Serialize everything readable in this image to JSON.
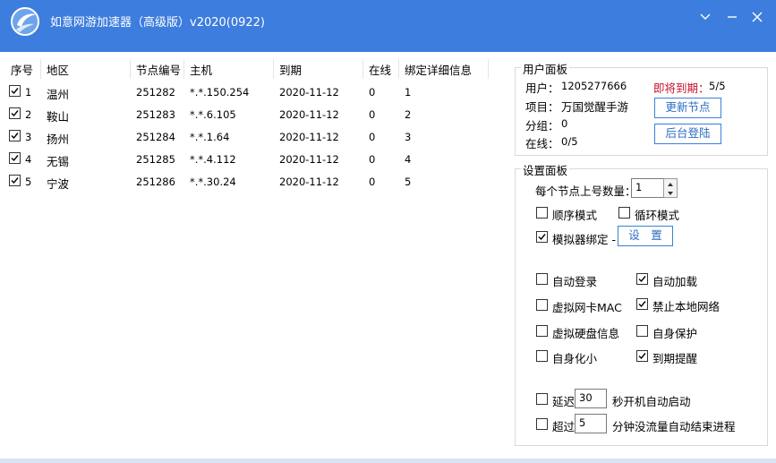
{
  "window": {
    "title": "如意网游加速器（高级版）v2020(0922)",
    "accent": "#3d7dde"
  },
  "table": {
    "headers": [
      "序号",
      "地区",
      "节点编号",
      "主机",
      "到期",
      "在线",
      "绑定详细信息"
    ],
    "rows": [
      {
        "checked": true,
        "index": "1",
        "region": "温州",
        "node": "251282",
        "host": "*.*.150.254",
        "expire": "2020-11-12",
        "online": "0",
        "bind": "1"
      },
      {
        "checked": true,
        "index": "2",
        "region": "鞍山",
        "node": "251283",
        "host": "*.*.6.105",
        "expire": "2020-11-12",
        "online": "0",
        "bind": "2"
      },
      {
        "checked": true,
        "index": "3",
        "region": "扬州",
        "node": "251284",
        "host": "*.*.1.64",
        "expire": "2020-11-12",
        "online": "0",
        "bind": "3"
      },
      {
        "checked": true,
        "index": "4",
        "region": "无锡",
        "node": "251285",
        "host": "*.*.4.112",
        "expire": "2020-11-12",
        "online": "0",
        "bind": "4"
      },
      {
        "checked": true,
        "index": "5",
        "region": "宁波",
        "node": "251286",
        "host": "*.*.30.24",
        "expire": "2020-11-12",
        "online": "0",
        "bind": "5"
      }
    ]
  },
  "user_panel": {
    "title": "用户面板",
    "user_label": "用户：",
    "user_value": "1205277666",
    "expiring_label": "即将到期：",
    "expiring_value": "5/5",
    "expiring_color": "#c8102e",
    "project_label": "项目：",
    "project_value": "万国觉醒手游",
    "group_label": "分组：",
    "group_value": "0",
    "online_label": "在线：",
    "online_value": "0/5",
    "update_button": "更新节点",
    "login_button": "后台登陆"
  },
  "settings_panel": {
    "title": "设置面板",
    "per_node_label": "每个节点上号数量：",
    "per_node_value": "1",
    "seq_mode": {
      "label": "顺序模式",
      "checked": false
    },
    "loop_mode": {
      "label": "循环模式",
      "checked": false
    },
    "emulator_bind": {
      "label": "模拟器绑定 -",
      "checked": true
    },
    "settings_button": "设　置",
    "auto_login": {
      "label": "自动登录",
      "checked": false
    },
    "auto_load": {
      "label": "自动加载",
      "checked": true
    },
    "virtual_mac": {
      "label": "虚拟网卡MAC",
      "checked": false
    },
    "block_local_net": {
      "label": "禁止本地网络",
      "checked": true
    },
    "virtual_disk": {
      "label": "虚拟硬盘信息",
      "checked": false
    },
    "self_protect": {
      "label": "自身保护",
      "checked": false
    },
    "self_minimize": {
      "label": "自身化小",
      "checked": false
    },
    "expire_remind": {
      "label": "到期提醒",
      "checked": true
    },
    "delay": {
      "label": "延迟",
      "checked": false,
      "value": "30",
      "suffix": "秒开机自动启动"
    },
    "timeout": {
      "label": "超过",
      "checked": false,
      "value": "5",
      "suffix": "分钟没流量自动结束进程"
    }
  }
}
